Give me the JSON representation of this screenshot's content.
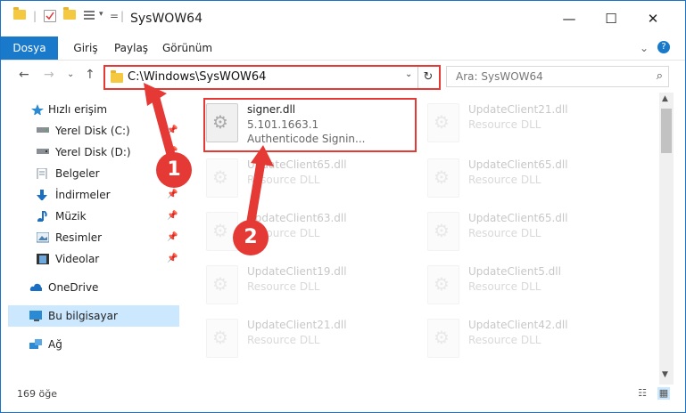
{
  "window": {
    "title": "SysWOW64",
    "controls": {
      "minimize": "—",
      "maximize": "☐",
      "close": "✕"
    },
    "quick_access": {
      "dropdown": "▾",
      "separator": "|",
      "customize": "="
    }
  },
  "ribbon": {
    "tabs": [
      "Dosya",
      "Giriş",
      "Paylaş",
      "Görünüm"
    ],
    "expand": "⌄",
    "help": "?"
  },
  "navigation": {
    "back": "←",
    "forward": "→",
    "recent": "⌄",
    "up": "↑",
    "address": "C:\\Windows\\SysWOW64",
    "address_dropdown": "⌄",
    "refresh": "↻",
    "search_placeholder": "Ara: SysWOW64",
    "search_icon": "⌕"
  },
  "sidebar": {
    "items": [
      {
        "label": "Hızlı erişim",
        "icon": "star-icon"
      },
      {
        "label": "Yerel Disk (C:)",
        "icon": "drive-icon",
        "pinned": true
      },
      {
        "label": "Yerel Disk (D:)",
        "icon": "drive-icon",
        "pinned": true
      },
      {
        "label": "Belgeler",
        "icon": "documents-icon",
        "pinned": true
      },
      {
        "label": "İndirmeler",
        "icon": "download-icon",
        "pinned": true
      },
      {
        "label": "Müzik",
        "icon": "music-icon",
        "pinned": true
      },
      {
        "label": "Resimler",
        "icon": "pictures-icon",
        "pinned": true
      },
      {
        "label": "Videolar",
        "icon": "video-icon",
        "pinned": true
      },
      {
        "label": "OneDrive",
        "icon": "cloud-icon"
      },
      {
        "label": "Bu bilgisayar",
        "icon": "computer-icon"
      },
      {
        "label": "Ağ",
        "icon": "network-icon"
      }
    ],
    "pin_glyph": "📌"
  },
  "files": {
    "selected": {
      "name": "signer.dll",
      "version": "5.101.1663.1",
      "description": "Authenticode Signin..."
    },
    "ghost": [
      {
        "name": "UpdateClient21.dll",
        "description": "Resource DLL"
      },
      {
        "name": "UpdateClient65.dll",
        "description": "Resource DLL"
      },
      {
        "name": "UpdateClient65.dll",
        "description": "Resource DLL"
      },
      {
        "name": "UpdateClient63.dll",
        "description": "Resource DLL"
      },
      {
        "name": "UpdateClient65.dll",
        "description": "Resource DLL"
      },
      {
        "name": "UpdateClient19.dll",
        "description": "Resource DLL"
      },
      {
        "name": "UpdateClient5.dll",
        "description": "Resource DLL"
      },
      {
        "name": "UpdateClient21.dll",
        "description": "Resource DLL"
      },
      {
        "name": "UpdateClient42.dll",
        "description": "Resource DLL"
      }
    ]
  },
  "scrollbar": {
    "up": "▲",
    "down": "▼"
  },
  "status": {
    "count": "169 öğe",
    "details_view": "☷",
    "tiles_view": "▦"
  },
  "callouts": [
    "1",
    "2"
  ],
  "colors": {
    "accent": "#1979ca",
    "highlight": "#e53935",
    "selection": "#cce8ff"
  }
}
